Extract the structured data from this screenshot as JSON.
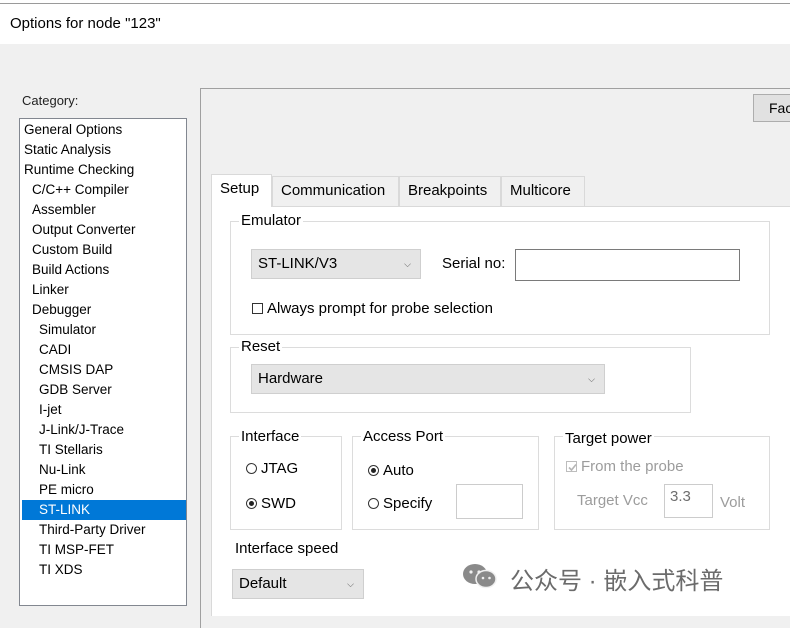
{
  "window": {
    "title": "Options for node \"123\""
  },
  "category": {
    "label": "Category:",
    "items": [
      "General Options",
      "Static Analysis",
      "Runtime Checking",
      "C/C++ Compiler",
      "Assembler",
      "Output Converter",
      "Custom Build",
      "Build Actions",
      "Linker",
      "Debugger",
      "Simulator",
      "CADI",
      "CMSIS DAP",
      "GDB Server",
      "I-jet",
      "J-Link/J-Trace",
      "TI Stellaris",
      "Nu-Link",
      "PE micro",
      "ST-LINK",
      "Third-Party Driver",
      "TI MSP-FET",
      "TI XDS"
    ],
    "selected": "ST-LINK"
  },
  "factory_button": "Factory Settings",
  "tabs": [
    "Setup",
    "Communication",
    "Breakpoints",
    "Multicore"
  ],
  "active_tab": "Setup",
  "emulator": {
    "label": "Emulator",
    "selected": "ST-LINK/V3",
    "serial_label": "Serial no:",
    "serial_value": "",
    "always_prompt_label": "Always prompt for probe selection",
    "always_prompt_checked": false
  },
  "reset": {
    "label": "Reset",
    "selected": "Hardware"
  },
  "interface": {
    "label": "Interface",
    "options": [
      "JTAG",
      "SWD"
    ],
    "selected": "SWD"
  },
  "access_port": {
    "label": "Access Port",
    "auto_label": "Auto",
    "specify_label": "Specify",
    "selected": "Auto",
    "value": ""
  },
  "target_power": {
    "label": "Target power",
    "from_probe_label": "From the probe",
    "from_probe_checked": true,
    "vcc_label": "Target Vcc",
    "vcc_value": "3.3",
    "vcc_unit": "Volt"
  },
  "interface_speed": {
    "label": "Interface speed",
    "selected": "Default"
  },
  "watermark": {
    "text": "公众号 · 嵌入式科普"
  }
}
